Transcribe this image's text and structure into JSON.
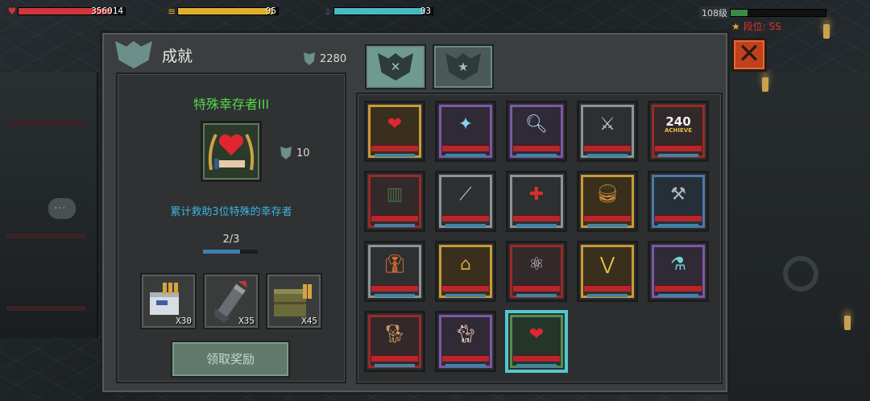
{
  "hud": {
    "health": {
      "icon": "heart-icon",
      "value": "356014",
      "fill": 0.87,
      "color": "#d0353b"
    },
    "food": {
      "icon": "food-icon",
      "value": "95",
      "fill": 0.95,
      "color": "#e0b02c"
    },
    "water": {
      "icon": "water-drop-icon",
      "value": "93",
      "fill": 0.93,
      "color": "#49b9c2"
    },
    "level": {
      "label": "108级",
      "fill": 0.18
    },
    "rank": {
      "label": "段位: SS"
    }
  },
  "window": {
    "title": "成就",
    "points": "2280",
    "tabs": [
      {
        "icon": "shield-crossed-icon",
        "active": true
      },
      {
        "icon": "shield-star-icon",
        "active": false
      }
    ],
    "close_icon": "close-icon"
  },
  "detail": {
    "name": "特殊幸存者III",
    "icon": "heart-hand-icon",
    "reward_points": "10",
    "description": "累计救助3位特殊的幸存者",
    "progress_text": "2/3",
    "progress_fraction": 0.67,
    "rewards": [
      {
        "icon": "ammo-box-icon",
        "qty": "X30"
      },
      {
        "icon": "rocket-icon",
        "qty": "X35"
      },
      {
        "icon": "ammo-crate-icon",
        "qty": "X45"
      }
    ],
    "claim_label": "领取奖励"
  },
  "achievements": [
    {
      "icon": "heart-hand-icon",
      "frame": "gold",
      "glyph": "❤",
      "color": "#e0262e"
    },
    {
      "icon": "burst-boot-icon",
      "frame": "purple",
      "glyph": "✦",
      "color": "#8ad0f0"
    },
    {
      "icon": "magnifier-check-icon",
      "frame": "purple",
      "glyph": "🔍︎",
      "color": "#b6d8f0"
    },
    {
      "icon": "crossed-weapons-icon",
      "frame": "silver",
      "glyph": "⚔",
      "color": "#c8c8c8"
    },
    {
      "icon": "achieve-240-icon",
      "frame": "red",
      "glyph": "240",
      "color": "#f2f2f2",
      "caption": "ACHIEVE"
    },
    {
      "icon": "armor-vest-icon",
      "frame": "red",
      "glyph": "▥",
      "color": "#4a6a48"
    },
    {
      "icon": "blade-icon",
      "frame": "silver",
      "glyph": "⟋",
      "color": "#a9c6d6"
    },
    {
      "icon": "medkit-bottle-icon",
      "frame": "silver",
      "glyph": "✚",
      "color": "#d4312c"
    },
    {
      "icon": "burger-icon",
      "frame": "gold",
      "glyph": "🍔︎",
      "color": "#c98a3a"
    },
    {
      "icon": "anvil-icon",
      "frame": "blue",
      "glyph": "⚒",
      "color": "#b0b6ba"
    },
    {
      "icon": "suit-icon",
      "frame": "silver",
      "glyph": "👔︎",
      "color": "#e06a30"
    },
    {
      "icon": "house-icon",
      "frame": "gold",
      "glyph": "⌂",
      "color": "#d8a040"
    },
    {
      "icon": "atom-icon",
      "frame": "red",
      "glyph": "⚛",
      "color": "#c8cbd0"
    },
    {
      "icon": "rank-chevrons-icon",
      "frame": "gold",
      "glyph": "⋁",
      "color": "#e2c14a"
    },
    {
      "icon": "potion-flask-icon",
      "frame": "purple",
      "glyph": "⚗",
      "color": "#6fd6d0"
    },
    {
      "icon": "dog-icon",
      "frame": "red",
      "glyph": "🐕︎",
      "color": "#c9955a"
    },
    {
      "icon": "cat-icon",
      "frame": "purple",
      "glyph": "🐈︎",
      "color": "#e8c8b0"
    },
    {
      "icon": "heart-hand-icon",
      "frame": "green",
      "glyph": "❤",
      "color": "#e0262e",
      "selected": true
    }
  ]
}
